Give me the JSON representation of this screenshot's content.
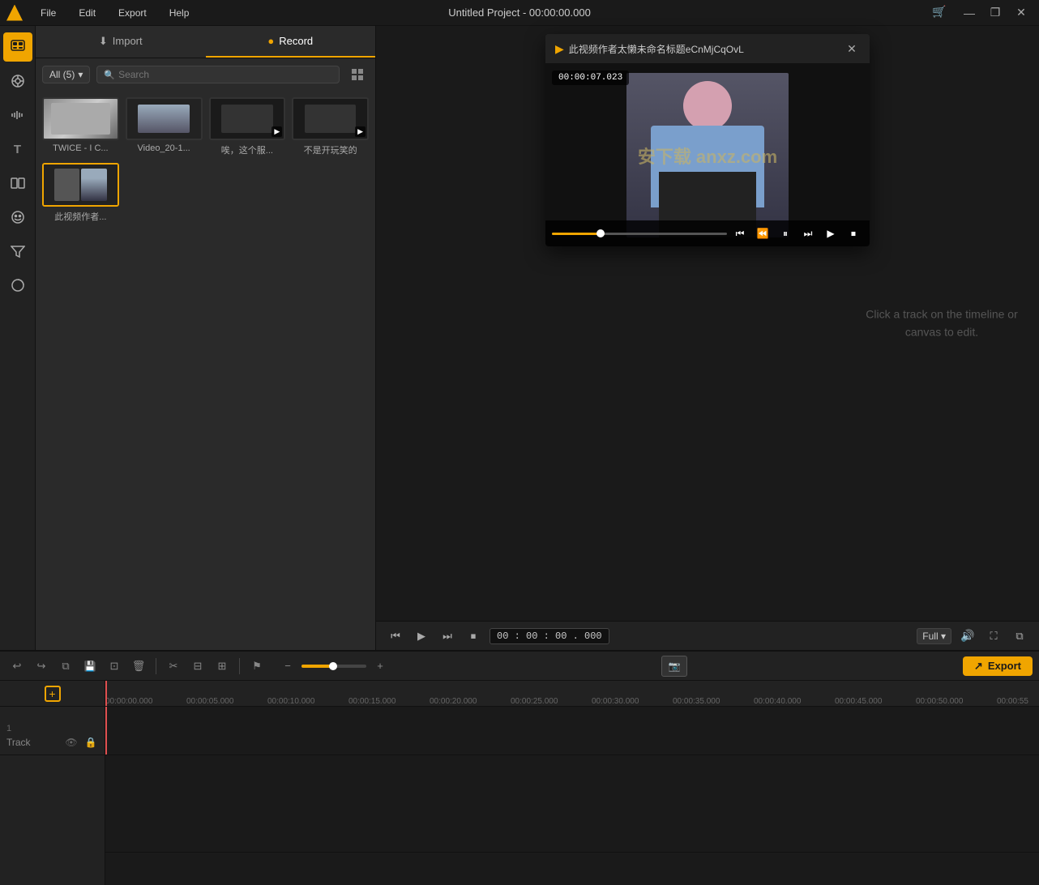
{
  "app": {
    "title": "Untitled Project - 00:00:00.000",
    "logo_symbol": "▲"
  },
  "titlebar": {
    "menus": [
      "File",
      "Edit",
      "Export",
      "Help"
    ],
    "window_buttons": [
      "—",
      "❐",
      "✕"
    ]
  },
  "sidebar": {
    "icons": [
      {
        "name": "media-icon",
        "symbol": "⊟",
        "active": true
      },
      {
        "name": "effects-icon",
        "symbol": "◈",
        "active": false
      },
      {
        "name": "audio-icon",
        "symbol": "≋",
        "active": false
      },
      {
        "name": "text-icon",
        "symbol": "T",
        "active": false
      },
      {
        "name": "transitions-icon",
        "symbol": "⊞",
        "active": false
      },
      {
        "name": "stickers-icon",
        "symbol": "❀",
        "active": false
      },
      {
        "name": "filter-icon",
        "symbol": "⊜",
        "active": false
      },
      {
        "name": "adjust-icon",
        "symbol": "◑",
        "active": false
      }
    ]
  },
  "media_panel": {
    "tabs": [
      {
        "label": "Import",
        "icon": "↓",
        "active": false
      },
      {
        "label": "Record",
        "icon": "●",
        "active": true
      }
    ],
    "filter": {
      "label": "All (5)",
      "placeholder": "Search"
    },
    "items": [
      {
        "name": "twice-ic",
        "label": "TWICE - I C...",
        "duration": ""
      },
      {
        "name": "video-20-1",
        "label": "Video_20-1...",
        "duration": ""
      },
      {
        "name": "weige-fuwu",
        "label": "唉，这个服...",
        "duration": ""
      },
      {
        "name": "bushi-wanxiao",
        "label": "不是开玩笑的",
        "duration": ""
      },
      {
        "name": "cishipinzuozhe",
        "label": "此视频作者...",
        "duration": "",
        "selected": true
      }
    ]
  },
  "popup": {
    "title": "此视频作者太懒未命名标题eCnMjCqOvL",
    "logo": "▶",
    "time_current": "00:00:07.023",
    "controls": {
      "rewind": "⏮",
      "step_back": "⏪",
      "pause": "⏸",
      "frame_step": "⏯",
      "play": "▶",
      "stop": "■"
    }
  },
  "preview": {
    "timecode": "00 : 00 : 00 . 000",
    "zoom": "Full",
    "hint_line1": "Click a track on the timeline or",
    "hint_line2": "canvas to edit."
  },
  "timeline_toolbar": {
    "buttons": [
      {
        "name": "undo-btn",
        "symbol": "↩"
      },
      {
        "name": "redo-btn",
        "symbol": "↪"
      },
      {
        "name": "copy-btn",
        "symbol": "⧉"
      },
      {
        "name": "save-btn",
        "symbol": "💾"
      },
      {
        "name": "saveas-btn",
        "symbol": "⊡"
      },
      {
        "name": "delete-btn",
        "symbol": "🗑"
      }
    ],
    "edit_buttons": [
      {
        "name": "cut-btn",
        "symbol": "✂"
      },
      {
        "name": "trim-btn",
        "symbol": "⊟"
      },
      {
        "name": "split-btn",
        "symbol": "⊞"
      }
    ],
    "marker_btn": "⚑",
    "zoom_minus": "−",
    "zoom_plus": "+",
    "snapshot_icon": "📷",
    "export_icon": "↗",
    "export_label": "Export"
  },
  "timeline": {
    "ruler_marks": [
      "00:00:00.000",
      "00:00:05.000",
      "00:00:10.000",
      "00:00:15.000",
      "00:00:20.000",
      "00:00:25.000",
      "00:00:30.000",
      "00:00:35.000",
      "00:00:40.000",
      "00:00:45.000",
      "00:00:50.000",
      "00:00:55"
    ],
    "track": {
      "number": "1",
      "name": "Track",
      "visibility_icon": "👁",
      "lock_icon": "🔒"
    }
  },
  "watermark": {
    "text": "安下载 anxz.com"
  }
}
